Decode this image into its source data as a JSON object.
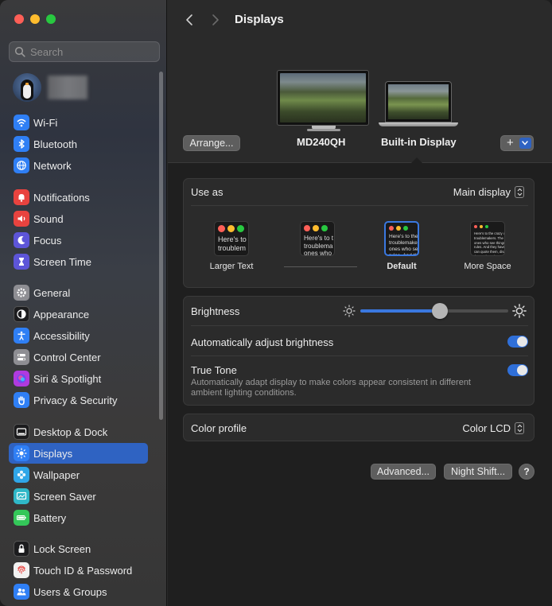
{
  "sidebar": {
    "search_placeholder": "Search",
    "items": [
      {
        "label": "Wi-Fi",
        "icon": "wifi-icon",
        "color": "#2f7ff5"
      },
      {
        "label": "Bluetooth",
        "icon": "bluetooth-icon",
        "color": "#2f7ff5"
      },
      {
        "label": "Network",
        "icon": "globe-icon",
        "color": "#2f7ff5"
      },
      {
        "label": "Notifications",
        "icon": "bell-icon",
        "color": "#e8433f"
      },
      {
        "label": "Sound",
        "icon": "speaker-icon",
        "color": "#e8433f"
      },
      {
        "label": "Focus",
        "icon": "moon-icon",
        "color": "#5d55d8"
      },
      {
        "label": "Screen Time",
        "icon": "hourglass-icon",
        "color": "#5d55d8"
      },
      {
        "label": "General",
        "icon": "gear-icon",
        "color": "#8e8e93"
      },
      {
        "label": "Appearance",
        "icon": "appearance-icon",
        "color": "#1c1c1e"
      },
      {
        "label": "Accessibility",
        "icon": "accessibility-icon",
        "color": "#2f7ff5"
      },
      {
        "label": "Control Center",
        "icon": "control-center-icon",
        "color": "#8e8e93"
      },
      {
        "label": "Siri & Spotlight",
        "icon": "siri-icon",
        "color": "#b03adf"
      },
      {
        "label": "Privacy & Security",
        "icon": "hand-icon",
        "color": "#2f7ff5"
      },
      {
        "label": "Desktop & Dock",
        "icon": "dock-icon",
        "color": "#1c1c1e"
      },
      {
        "label": "Displays",
        "icon": "sun-icon",
        "color": "#2f7ff5"
      },
      {
        "label": "Wallpaper",
        "icon": "flower-icon",
        "color": "#2fa6e8"
      },
      {
        "label": "Screen Saver",
        "icon": "screen-saver-icon",
        "color": "#2fb8c8"
      },
      {
        "label": "Battery",
        "icon": "battery-icon",
        "color": "#34c759"
      },
      {
        "label": "Lock Screen",
        "icon": "lock-icon",
        "color": "#1c1c1e"
      },
      {
        "label": "Touch ID & Password",
        "icon": "fingerprint-icon",
        "color": "#f2f2f2"
      },
      {
        "label": "Users & Groups",
        "icon": "users-icon",
        "color": "#2f7ff5"
      }
    ],
    "selected": "Displays"
  },
  "toolbar": {
    "title": "Displays"
  },
  "displays": {
    "arrange_label": "Arrange...",
    "external_name": "MD240QH",
    "builtin_name": "Built-in Display",
    "add_label": "+"
  },
  "use_as": {
    "label": "Use as",
    "value": "Main display"
  },
  "resolution": {
    "options": [
      {
        "label": "Larger Text",
        "preview": "Here's to\ntroublem"
      },
      {
        "label": "",
        "preview": "Here's to t\ntroublema\nones who"
      },
      {
        "label": "Default",
        "preview": "Here's to the c\ntroublemakers\nones who see t\nrules. And they"
      },
      {
        "label": "More Space",
        "preview": "Here's to the crazy one\ntroublemakers. The round\nones who see things diffe\nrules. And they have no r\ncan quote them, disagree\nthem. About the only thing\nBecause they change thi"
      }
    ],
    "selected": "Default"
  },
  "brightness": {
    "label": "Brightness",
    "level": 0.54
  },
  "auto_brightness": {
    "label": "Automatically adjust brightness",
    "on": true
  },
  "true_tone": {
    "label": "True Tone",
    "description_line1": "Automatically adapt display to make colors appear consistent in different",
    "description_line2": "ambient lighting conditions.",
    "on": true
  },
  "color_profile": {
    "label": "Color profile",
    "value": "Color LCD"
  },
  "footer": {
    "advanced_label": "Advanced...",
    "night_shift_label": "Night Shift...",
    "help_label": "?"
  },
  "colors": {
    "accent": "#2f63c2",
    "toggle_on": "#2f6fd8",
    "slider_fill": "#3a78e0"
  }
}
